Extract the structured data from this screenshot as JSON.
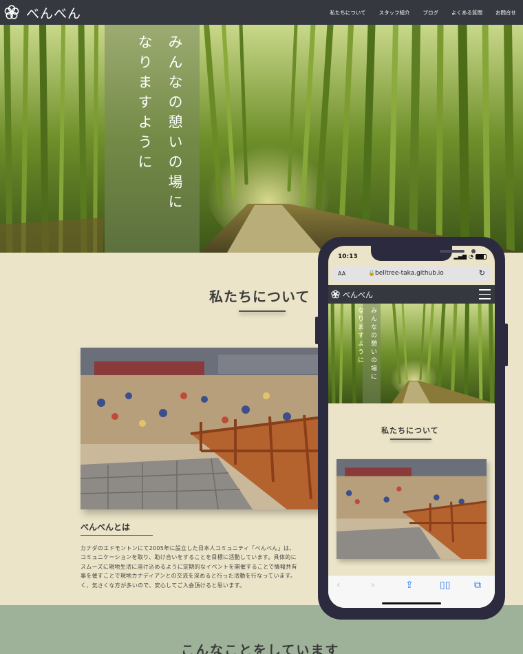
{
  "site": {
    "name": "べんべん",
    "nav": [
      "私たちについて",
      "スタッフ紹介",
      "ブログ",
      "よくある質問",
      "お問合せ"
    ]
  },
  "hero": {
    "line1": "みんなの憩いの場に",
    "line2": "なりますように"
  },
  "about": {
    "title": "私たちについて",
    "subtitle": "べんべんとは",
    "body": "カナダのエドモントンにて2005年に設立した日本人コミュニティ「べんべん」は、\nコミュニケーションを取り、助け合いをすることを目標に活動しています。具体的に\nスムーズに現地生活に溶け込めるように定期的なイベントを開催することで情報共有\n事を催すことで現地カナディアンとの交流を深めると行った活動を行なっています。\nく、気さくな方が多いので、安心してご入会頂けると思います。"
  },
  "next_section": {
    "title": "こんなことをしています"
  },
  "phone": {
    "time": "10:13",
    "url_aa": "AA",
    "url": "belltree-taka.github.io",
    "site_name": "べんべん",
    "hero_line1": "みんなの憩いの場に",
    "hero_line2": "なりますように",
    "about_title": "私たちについて"
  },
  "colors": {
    "header": "#35393f",
    "background": "#ebe4c8",
    "accent_green": "#9db298",
    "phone_frame": "#2b2a3e",
    "ios_blue": "#2f7ae8"
  },
  "icons": {
    "logo": "flower-logo-icon",
    "menu": "hamburger-menu-icon",
    "lock": "lock-icon",
    "reload": "reload-icon",
    "back": "back-arrow-icon",
    "forward": "forward-arrow-icon",
    "share": "share-icon",
    "bookmarks": "bookmarks-icon",
    "tabs": "tabs-icon"
  }
}
